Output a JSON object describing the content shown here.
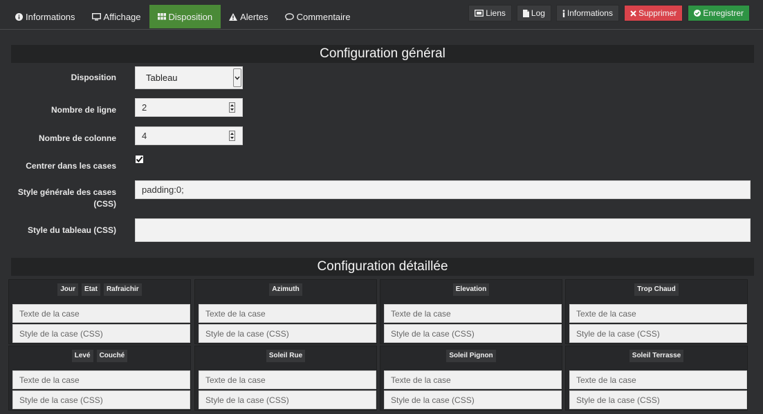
{
  "nav": {
    "tabs": [
      {
        "label": "Informations",
        "icon": "info-circle-icon",
        "active": false
      },
      {
        "label": "Affichage",
        "icon": "desktop-icon",
        "active": false
      },
      {
        "label": "Disposition",
        "icon": "grid-icon",
        "active": true
      },
      {
        "label": "Alertes",
        "icon": "warning-icon",
        "active": false
      },
      {
        "label": "Commentaire",
        "icon": "comment-icon",
        "active": false
      }
    ],
    "actions": [
      {
        "label": "Liens",
        "icon": "link-icon"
      },
      {
        "label": "Log",
        "icon": "file-icon"
      },
      {
        "label": "Informations",
        "icon": "info-icon"
      },
      {
        "label": "Supprimer",
        "icon": "close-icon",
        "color": "#d9434b"
      },
      {
        "label": "Enregistrer",
        "icon": "check-circle-icon",
        "color": "#2e9444"
      }
    ]
  },
  "general": {
    "title": "Configuration général",
    "disposition_label": "Disposition",
    "disposition_value": "Tableau",
    "rows_label": "Nombre de ligne",
    "rows_value": "2",
    "cols_label": "Nombre de colonne",
    "cols_value": "4",
    "center_label": "Centrer dans les cases",
    "center_checked": true,
    "cell_style_label_1": "Style générale des cases",
    "cell_style_label_2": "(CSS)",
    "cell_style_value": "padding:0;",
    "table_style_label": "Style du tableau (CSS)",
    "table_style_value": ""
  },
  "detail": {
    "title": "Configuration détaillée",
    "text_placeholder": "Texte de la case",
    "style_placeholder": "Style de la case (CSS)",
    "cells": [
      {
        "chips": [
          "Jour",
          "Etat",
          "Rafraichir"
        ]
      },
      {
        "chips": [
          "Azimuth"
        ]
      },
      {
        "chips": [
          "Elevation"
        ]
      },
      {
        "chips": [
          "Trop Chaud"
        ]
      },
      {
        "chips": [
          "Levé",
          "Couché"
        ]
      },
      {
        "chips": [
          "Soleil Rue"
        ]
      },
      {
        "chips": [
          "Soleil Pignon"
        ]
      },
      {
        "chips": [
          "Soleil Terrasse"
        ]
      }
    ]
  },
  "colors": {
    "accent": "#4a8a37",
    "danger": "#d9434b",
    "success": "#2e9444",
    "background": "#2e2f31"
  }
}
